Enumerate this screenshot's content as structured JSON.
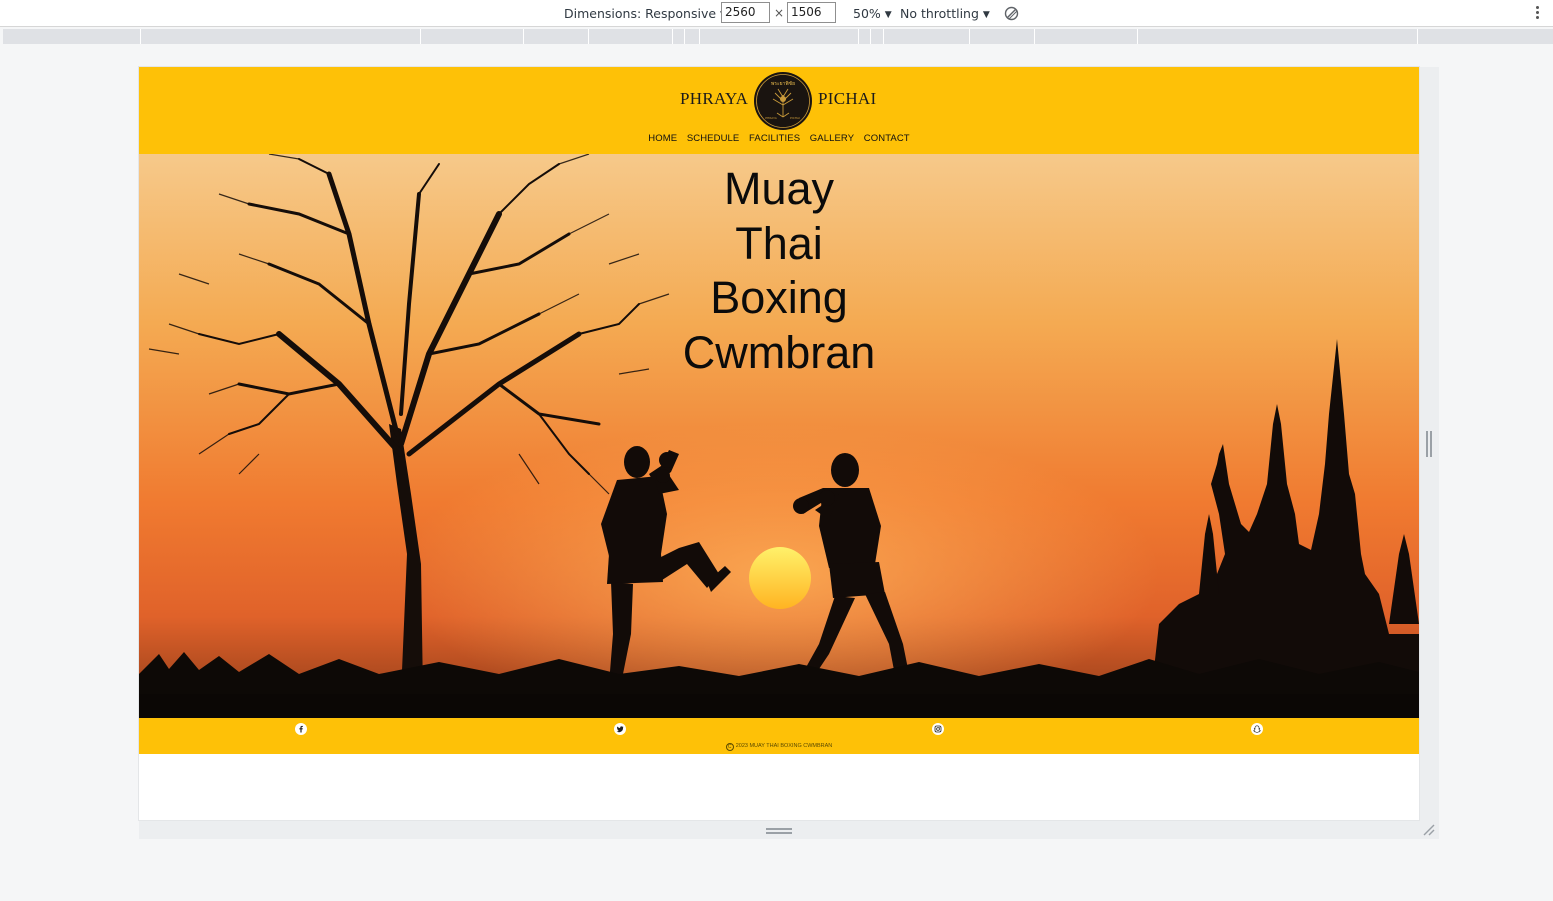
{
  "devtools": {
    "dimensions_label": "Dimensions: Responsive",
    "width_value": "2560",
    "height_value": "1506",
    "times_sign": "×",
    "zoom": "50%",
    "throttling": "No throttling",
    "caret": "▼",
    "rotate_icon": "rotate-icon",
    "more_icon": "more-vertical-icon"
  },
  "site": {
    "brand_left": "PHRAYA",
    "brand_right": "PICHAI",
    "logo_text": "พระยาพิชัย",
    "logo_sub_left": "PHRAYA",
    "logo_sub_right": "PICHAI",
    "nav": [
      "HOME",
      "SCHEDULE",
      "FACILITIES",
      "GALLERY",
      "CONTACT"
    ],
    "hero_title_lines": [
      "Muay",
      "Thai",
      "Boxing",
      "Cwmbran"
    ],
    "social_icons": [
      "facebook-icon",
      "twitter-icon",
      "instagram-icon",
      "snapchat-icon"
    ],
    "copyright_symbol": "C",
    "copyright": "2023 MUAY THAI BOXING CWMBRAN"
  },
  "colors": {
    "brand_yellow": "#fec107",
    "sky_top": "#f5c27a",
    "sky_mid": "#f39a3f",
    "sky_low": "#ee6c2a",
    "silhouette": "#120b08",
    "sun": "#ffe23a"
  }
}
